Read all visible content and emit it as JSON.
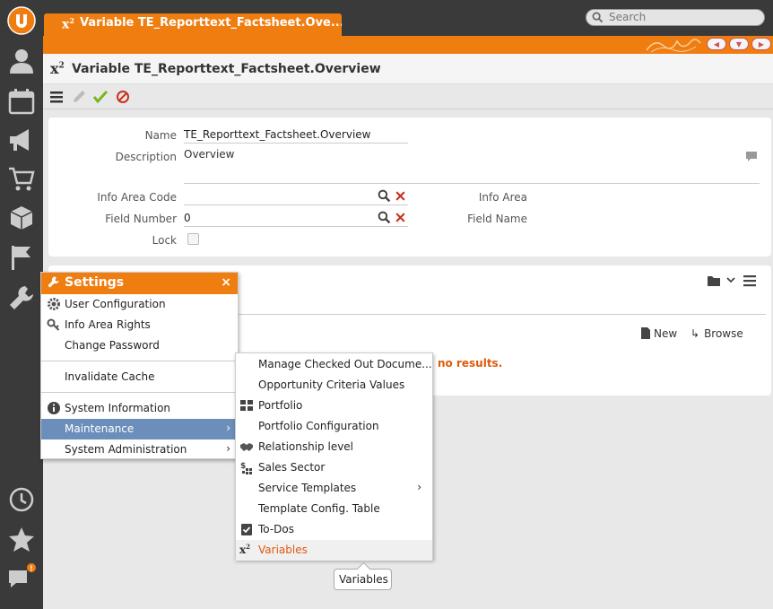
{
  "tab": {
    "title": "Variable TE_Reporttext_Factsheet.Ove..."
  },
  "search": {
    "placeholder": "Search"
  },
  "header": {
    "title": "Variable TE_Reporttext_Factsheet.Overview"
  },
  "form": {
    "name_label": "Name",
    "name_value": "TE_Reporttext_Factsheet.Overview",
    "description_label": "Description",
    "description_value": "Overview",
    "info_area_code_label": "Info Area Code",
    "info_area_code_value": "",
    "info_area_label": "Info Area",
    "field_number_label": "Field Number",
    "field_number_value": "0",
    "field_name_label": "Field Name",
    "lock_label": "Lock"
  },
  "panel2": {
    "no_results": "no results.",
    "new_label": "New",
    "browse_label": "Browse"
  },
  "settings": {
    "title": "Settings",
    "items": [
      {
        "label": "User Configuration",
        "icon": "gear-icon"
      },
      {
        "label": "Info Area Rights",
        "icon": "key-icon"
      },
      {
        "label": "Change Password",
        "icon": ""
      },
      {
        "label": "Invalidate Cache",
        "icon": ""
      },
      {
        "label": "System Information",
        "icon": "info-icon"
      },
      {
        "label": "Maintenance",
        "icon": "",
        "selected": true
      },
      {
        "label": "System Administration",
        "icon": ""
      }
    ]
  },
  "submenu": {
    "items": [
      {
        "label": "Manage Checked Out Docume..."
      },
      {
        "label": "Opportunity Criteria Values"
      },
      {
        "label": "Portfolio",
        "icon": "grid-icon"
      },
      {
        "label": "Portfolio Configuration"
      },
      {
        "label": "Relationship level",
        "icon": "handshake-icon"
      },
      {
        "label": "Sales Sector",
        "icon": "sales-sector-icon"
      },
      {
        "label": "Service Templates"
      },
      {
        "label": "Template Config. Table"
      },
      {
        "label": "To-Dos",
        "icon": "checklist-icon"
      },
      {
        "label": "Variables",
        "icon": "variable-icon",
        "highlighted": true
      }
    ]
  },
  "tooltip": {
    "text": "Variables"
  },
  "colors": {
    "accent": "#f07d10",
    "sidebar": "#3a3a3a",
    "selected": "#6c8eba",
    "error": "#e05a0a"
  }
}
